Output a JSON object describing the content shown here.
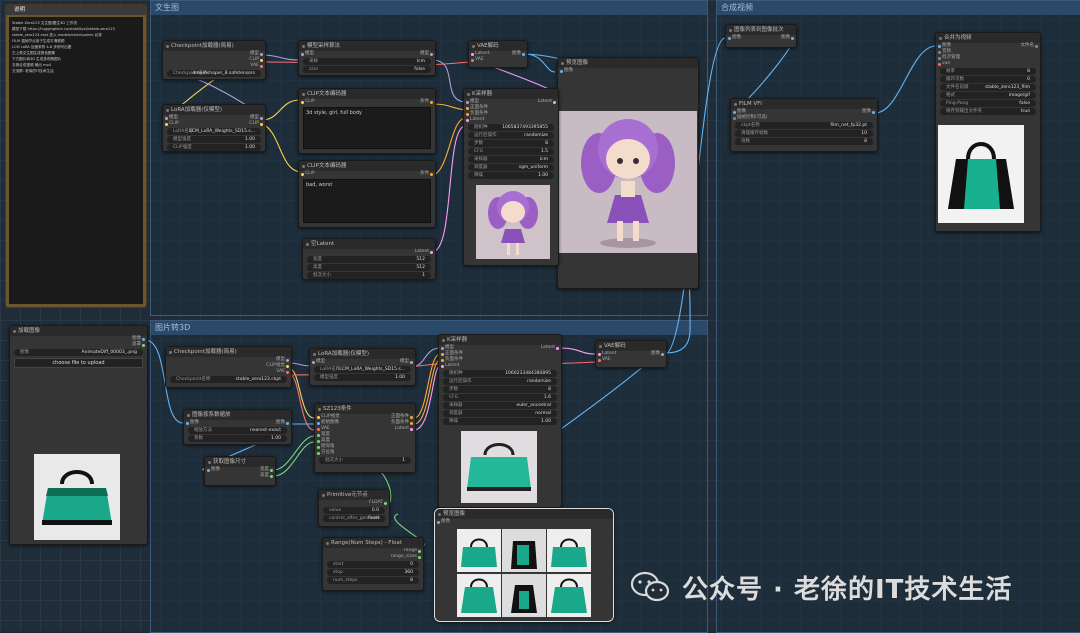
{
  "groups": {
    "txt2img": "文生图",
    "img2img": "图片转3D",
    "compose": "合成视频"
  },
  "note": {
    "title": "说明",
    "lines": [
      "Stable Zero123 文生图/图生3D 工作流",
      "模型下载 https://huggingface.co/stabilityai/stable-zero123",
      "stable_zero123.ckpt 放入 models/checkpoints 目录",
      "FILM 插帧节点用于生成平滑视频",
      "LCM LoRA 加速采样 4-8 步即可出图",
      "左上角文生图生成角色图像",
      "下方图片转3D 生成多视角图片",
      "右侧合成视频 输出 mp4",
      "交流群: 老徐的IT技术生活"
    ]
  },
  "nodes": {
    "ckpt1": {
      "title": "Checkpoint加载器(简易)",
      "out": [
        "模型",
        "CLIP",
        "VAE"
      ],
      "w1l": "Checkpoint名称",
      "w1v": "dreamshaper_8.safetensors"
    },
    "lora1": {
      "title": "LoRA加载器(仅模型)",
      "in": [
        "模型",
        "CLIP"
      ],
      "out": [
        "模型",
        "CLIP"
      ],
      "w1l": "LoRA名称",
      "w1v": "LCM_LoRA_Weights_SD15.s...",
      "w2l": "模型强度",
      "w2v": "1.00",
      "w3l": "CLIP强度",
      "w3v": "1.00"
    },
    "sampling": {
      "title": "模型采样算法",
      "in": [
        "模型"
      ],
      "out": [
        "模型"
      ],
      "w1l": "采样",
      "w1v": "lcm",
      "w2l": "zsnr",
      "w2v": "false"
    },
    "vaedec1": {
      "title": "VAE解码",
      "in": [
        "Latent",
        "VAE"
      ],
      "out": [
        "图像"
      ]
    },
    "preview1": {
      "title": "预览图像",
      "in": [
        "图像"
      ]
    },
    "clipPos": {
      "title": "CLIP文本编码器",
      "in": [
        "CLIP"
      ],
      "out": [
        "条件"
      ],
      "text": "3d style, girl, full body"
    },
    "clipNeg": {
      "title": "CLIP文本编码器",
      "in": [
        "CLIP"
      ],
      "out": [
        "条件"
      ],
      "text": "bad, worst"
    },
    "ksampler1": {
      "title": "K采样器",
      "in": [
        "模型",
        "正面条件",
        "负面条件",
        "Latent"
      ],
      "out": [
        "Latent"
      ],
      "widgets": [
        [
          "随机种",
          "1065837493395855"
        ],
        [
          "运行后操作",
          "randomize"
        ],
        [
          "步数",
          "8"
        ],
        [
          "CFG",
          "1.5"
        ],
        [
          "采样器",
          "lcm"
        ],
        [
          "调度器",
          "sgm_uniform"
        ],
        [
          "降噪",
          "1.00"
        ]
      ]
    },
    "latent1": {
      "title": "空Latent",
      "out": [
        "Latent"
      ],
      "widgets": [
        [
          "宽度",
          "512"
        ],
        [
          "高度",
          "512"
        ],
        [
          "批次大小",
          "1"
        ]
      ]
    },
    "loadimg": {
      "title": "加载图像",
      "out": [
        "图像",
        "遮罩"
      ],
      "w1l": "图像",
      "w1v": "AnimateDiff_00003_.png",
      "btn": "choose file to upload"
    },
    "ckpt2": {
      "title": "Checkpoint加载器(简易)",
      "out": [
        "模型",
        "CLIP视觉",
        "VAE"
      ],
      "w1l": "Checkpoint名称",
      "w1v": "stable_zero123.ckpt"
    },
    "lora2": {
      "title": "LoRA加载器(仅模型)",
      "in": [
        "模型"
      ],
      "out": [
        "模型"
      ],
      "w1l": "LoRA名称",
      "w1v": "LCM_LoRA_Weights_SD15.s...",
      "w2l": "模型强度",
      "w2v": "1.00"
    },
    "upscale": {
      "title": "图像按系数缩放",
      "in": [
        "图像"
      ],
      "out": [
        "图像"
      ],
      "w1l": "缩放方法",
      "w1v": "nearest-exact",
      "w2l": "系数",
      "w2v": "1.00"
    },
    "getsize": {
      "title": "获取图像尺寸",
      "in": [
        "图像"
      ],
      "out": [
        "宽度",
        "高度"
      ]
    },
    "sv3d": {
      "title": "SZ123条件",
      "in": [
        "CLIP视觉",
        "初始图像",
        "VAE",
        "宽度",
        "高度",
        "俯仰角",
        "方位角"
      ],
      "out": [
        "正面条件",
        "负面条件",
        "Latent"
      ],
      "w1l": "批次大小",
      "w1v": "1"
    },
    "ksampler2": {
      "title": "K采样器",
      "in": [
        "模型",
        "正面条件",
        "负面条件",
        "Latent"
      ],
      "out": [
        "Latent"
      ],
      "widgets": [
        [
          "随机种",
          "1060233484380895"
        ],
        [
          "运行后操作",
          "randomize"
        ],
        [
          "步数",
          "8"
        ],
        [
          "CFG",
          "1.6"
        ],
        [
          "采样器",
          "euler_ancestral"
        ],
        [
          "调度器",
          "normal"
        ],
        [
          "降噪",
          "1.00"
        ]
      ]
    },
    "vaedec2": {
      "title": "VAE解码",
      "in": [
        "Latent",
        "VAE"
      ],
      "out": [
        "图像"
      ]
    },
    "primitive": {
      "title": "Primitive元节点",
      "out": [
        "FLOAT"
      ],
      "w1l": "value",
      "w1v": "0.0",
      "w2l": "control_after_generate",
      "w2v": "fixed"
    },
    "range": {
      "title": "Range(Num Steps) - Float",
      "out": [
        "range",
        "range_sizes"
      ],
      "widgets": [
        [
          "start",
          "0"
        ],
        [
          "stop",
          "360"
        ],
        [
          "num_steps",
          "8"
        ]
      ]
    },
    "preview2": {
      "title": "预览图像",
      "in": [
        "图像"
      ]
    },
    "batch2img": {
      "title": "图像列表到图像批次",
      "in": [
        "图像"
      ],
      "out": [
        "图像"
      ]
    },
    "film": {
      "title": "FILM VFI",
      "in": [
        "图像",
        "插帧控制(可选)"
      ],
      "out": [
        "图像"
      ],
      "widgets": [
        [
          "ckpt名称",
          "film_net_fp32.pt"
        ],
        [
          "清理缓存帧数",
          "10"
        ],
        [
          "倍数",
          "8"
        ]
      ]
    },
    "combine": {
      "title": "合并为视频",
      "in": [
        "图像",
        "音频",
        "批次管理",
        "vae"
      ],
      "out": [
        "文件名"
      ],
      "widgets": [
        [
          "帧率",
          "8"
        ],
        [
          "循环次数",
          "0"
        ],
        [
          "文件名前缀",
          "stable_zero123_film"
        ],
        [
          "格式",
          "image/gif"
        ],
        [
          "Ping-Pong",
          "false"
        ],
        [
          "保存到输出文件夹",
          "true"
        ]
      ]
    }
  },
  "watermark": "公众号 · 老徐的IT技术生活",
  "colors": {
    "model": "#b39ddb",
    "clip": "#ffd54f",
    "vae": "#ff6e6e",
    "cond": "#ffa931",
    "latent": "#ff9cf9",
    "image": "#64b5f6",
    "int": "#7fd67f"
  }
}
